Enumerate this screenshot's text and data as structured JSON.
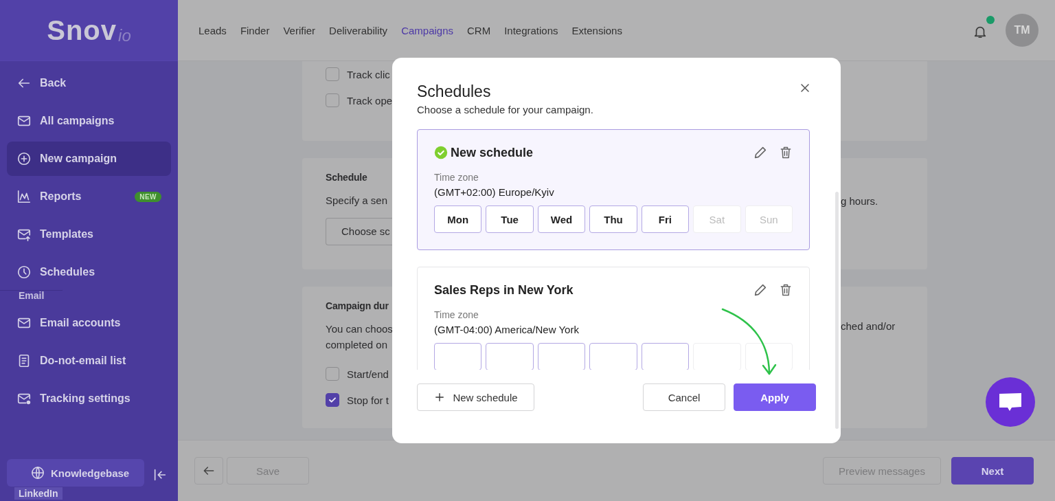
{
  "sidebar": {
    "logo": "Snov",
    "logo_suffix": "io",
    "items": [
      {
        "label": "Back",
        "selected": false
      },
      {
        "label": "All campaigns",
        "selected": false
      },
      {
        "label": "New campaign",
        "selected": true
      },
      {
        "label": "Reports",
        "selected": false,
        "badge": "NEW"
      },
      {
        "label": "Templates",
        "selected": false
      },
      {
        "label": "Schedules",
        "selected": false
      }
    ],
    "section": "Email",
    "email_items": [
      {
        "label": "Email accounts",
        "selected": false
      },
      {
        "label": "Do-not-email list",
        "selected": false
      },
      {
        "label": "Tracking settings",
        "selected": false
      }
    ],
    "knowledgebase": "Knowledgebase",
    "overlay_label": "LinkedIn"
  },
  "nav": {
    "items": [
      {
        "label": "Leads",
        "selected": false
      },
      {
        "label": "Finder",
        "selected": false
      },
      {
        "label": "Verifier",
        "selected": false
      },
      {
        "label": "Deliverability",
        "selected": false
      },
      {
        "label": "Campaigns",
        "selected": true
      },
      {
        "label": "CRM",
        "selected": false
      },
      {
        "label": "Integrations",
        "selected": false
      },
      {
        "label": "Extensions",
        "selected": false
      }
    ],
    "unread": true,
    "avatar": "TM"
  },
  "page": {
    "tracking": [
      {
        "label": "Track clic",
        "checked": false
      },
      {
        "label": "Track ope",
        "checked": false
      }
    ],
    "schedule_section": {
      "title": "Schedule",
      "text": "Specify a sen",
      "text_end": "g hours.",
      "button": "Choose sc"
    },
    "duration_section": {
      "title": "Campaign dur",
      "text_lines": [
        "You can choos",
        "completed on"
      ],
      "text_end": "ched and/or",
      "options": [
        {
          "label": "Start/end",
          "checked": false
        },
        {
          "label": "Stop for t",
          "checked": true
        }
      ]
    }
  },
  "footer": {
    "save": "Save",
    "preview": "Preview messages",
    "next": "Next"
  },
  "modal": {
    "title": "Schedules",
    "subtitle": "Choose a schedule for your campaign.",
    "schedules": [
      {
        "name": "New schedule",
        "selected": true,
        "timezone_label": "Time zone",
        "timezone": "(GMT+02:00) Europe/Kyiv",
        "days": [
          {
            "label": "Mon",
            "active": true
          },
          {
            "label": "Tue",
            "active": true
          },
          {
            "label": "Wed",
            "active": true
          },
          {
            "label": "Thu",
            "active": true
          },
          {
            "label": "Fri",
            "active": true
          },
          {
            "label": "Sat",
            "active": false
          },
          {
            "label": "Sun",
            "active": false
          }
        ]
      },
      {
        "name": "Sales Reps in New York",
        "selected": false,
        "timezone_label": "Time zone",
        "timezone": "(GMT-04:00) America/New York",
        "days": [
          {
            "active": true
          },
          {
            "active": true
          },
          {
            "active": true
          },
          {
            "active": true
          },
          {
            "active": true
          },
          {
            "active": false
          },
          {
            "active": false
          }
        ]
      }
    ],
    "new_button": "New schedule",
    "cancel": "Cancel",
    "apply": "Apply"
  }
}
